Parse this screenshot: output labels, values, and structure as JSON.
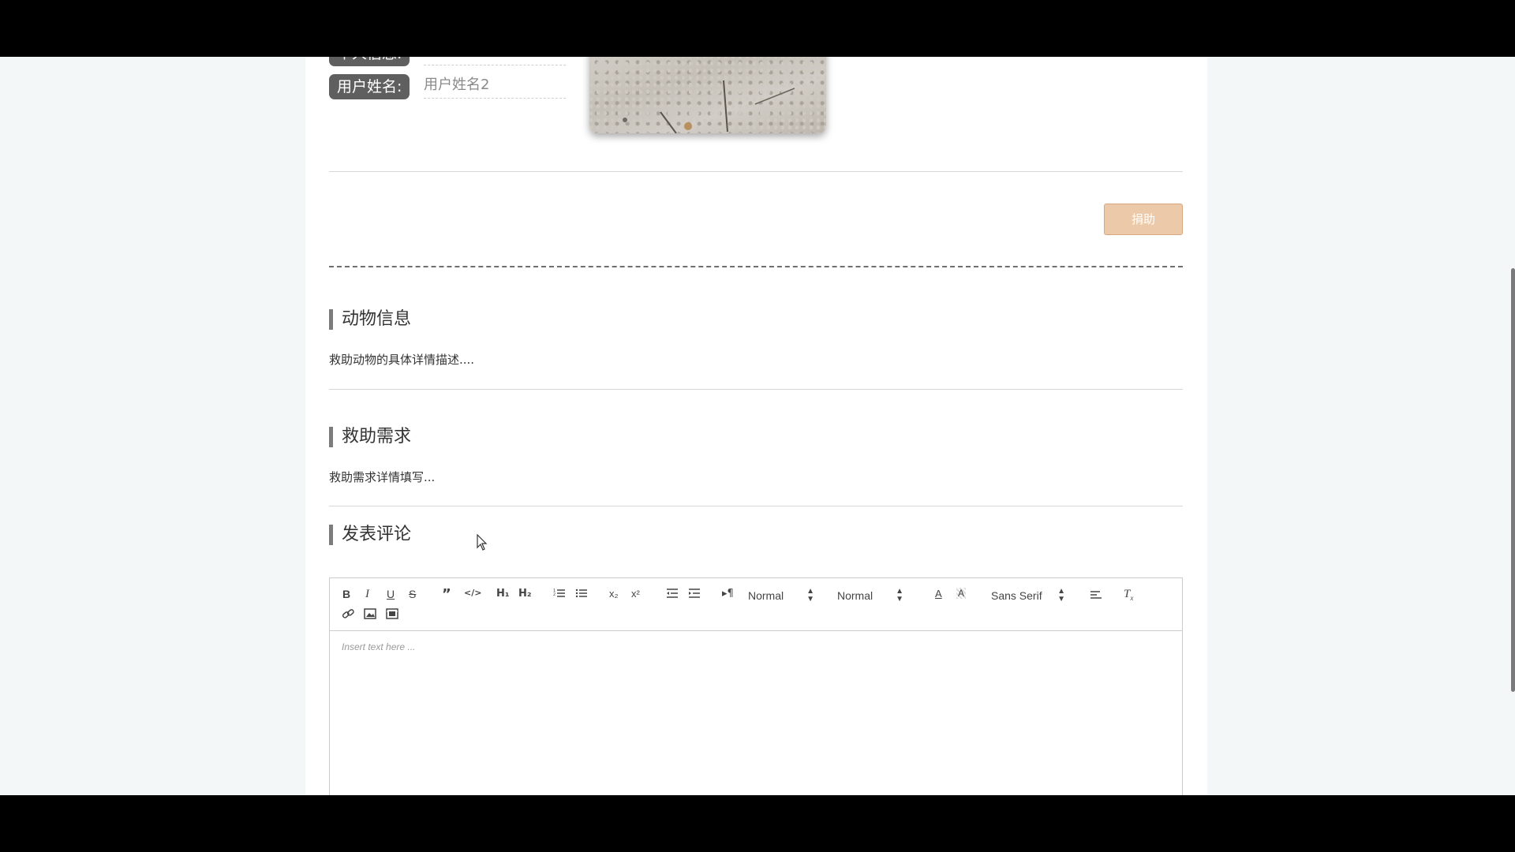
{
  "user": {
    "partial_label": "个人信息:",
    "name_label": "用户姓名:",
    "name_value": "用户姓名2"
  },
  "donate_button": "捐助",
  "sections": {
    "animal_info": {
      "title": "动物信息",
      "text": "救助动物的具体详情描述...."
    },
    "rescue_needs": {
      "title": "救助需求",
      "text": "救助需求详情填写..."
    },
    "comment": {
      "title": "发表评论"
    }
  },
  "editor": {
    "toolbar": {
      "header_select": "Normal",
      "size_select": "Normal",
      "font_select": "Sans Serif",
      "icons": [
        "bold-icon",
        "italic-icon",
        "underline-icon",
        "strike-icon",
        "blockquote-icon",
        "code-block-icon",
        "header1-icon",
        "header2-icon",
        "ordered-list-icon",
        "bullet-list-icon",
        "subscript-icon",
        "superscript-icon",
        "outdent-icon",
        "indent-icon",
        "rtl-icon",
        "font-color-icon",
        "background-color-icon",
        "align-icon",
        "clean-format-icon",
        "link-icon",
        "image-icon",
        "video-icon"
      ]
    },
    "placeholder": "Insert text here ..."
  },
  "colors": {
    "label_bg": "#5f5f5f",
    "donate_bg": "#ecc9a8",
    "page_bg": "#f3f7f7"
  }
}
